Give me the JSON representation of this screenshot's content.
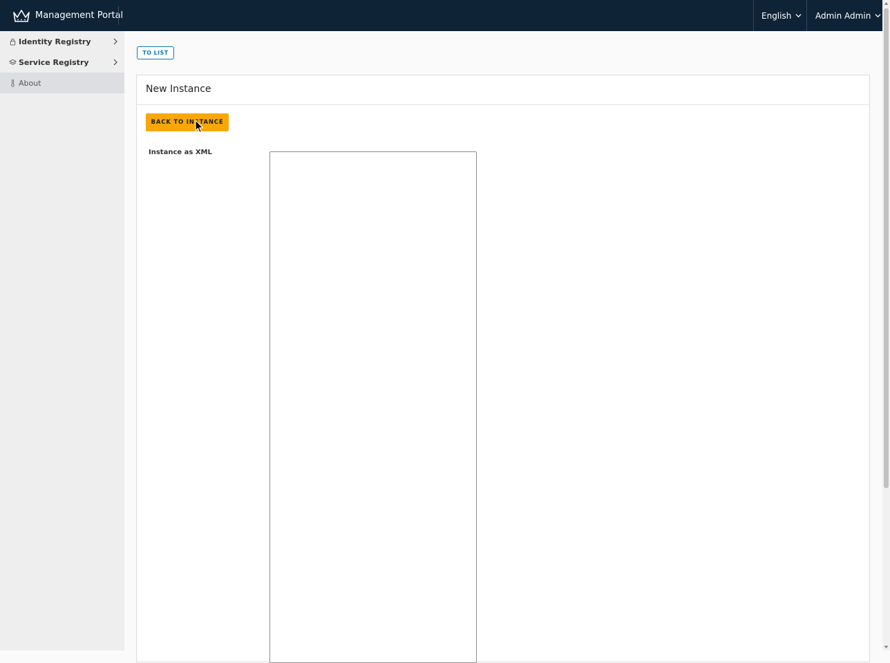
{
  "header": {
    "app_title": "Management Portal",
    "language": "English",
    "user": "Admin Admin",
    "brand_color": "#0f2337"
  },
  "sidebar": {
    "items": [
      {
        "label": "Identity Registry",
        "icon": "lock-icon"
      },
      {
        "label": "Service Registry",
        "icon": "layers-icon"
      },
      {
        "label": "About",
        "icon": "thermometer-icon"
      }
    ]
  },
  "main": {
    "to_list_label": "TO LIST",
    "card_title": "New Instance",
    "back_button_label": "BACK TO INSTANCE",
    "xml_field_label": "Instance as XML",
    "xml_value": "",
    "accent_color": "#f7a808"
  }
}
